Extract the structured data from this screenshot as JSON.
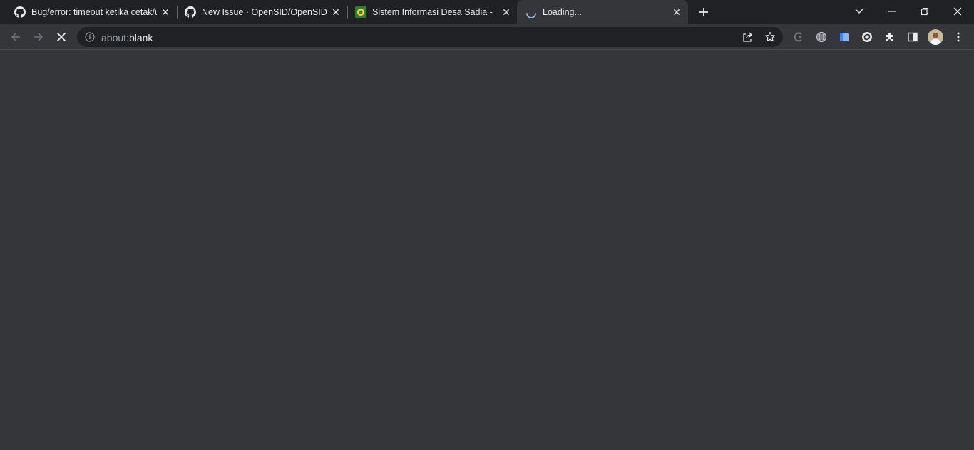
{
  "tabs": [
    {
      "title": "Bug/error: timeout ketika cetak/u",
      "favicon": "github-icon",
      "active": false
    },
    {
      "title": "New Issue · OpenSID/OpenSID",
      "favicon": "github-icon",
      "active": false
    },
    {
      "title": "Sistem Informasi Desa Sadia - Bu",
      "favicon": "village-logo-icon",
      "active": false
    },
    {
      "title": "Loading...",
      "favicon": "loading-spinner-icon",
      "active": true
    }
  ],
  "address_bar": {
    "scheme": "about:",
    "rest": "blank"
  },
  "colors": {
    "tabstrip": "#202124",
    "toolbar": "#35363a",
    "omnibox": "#202124",
    "text": "#e8eaed"
  }
}
